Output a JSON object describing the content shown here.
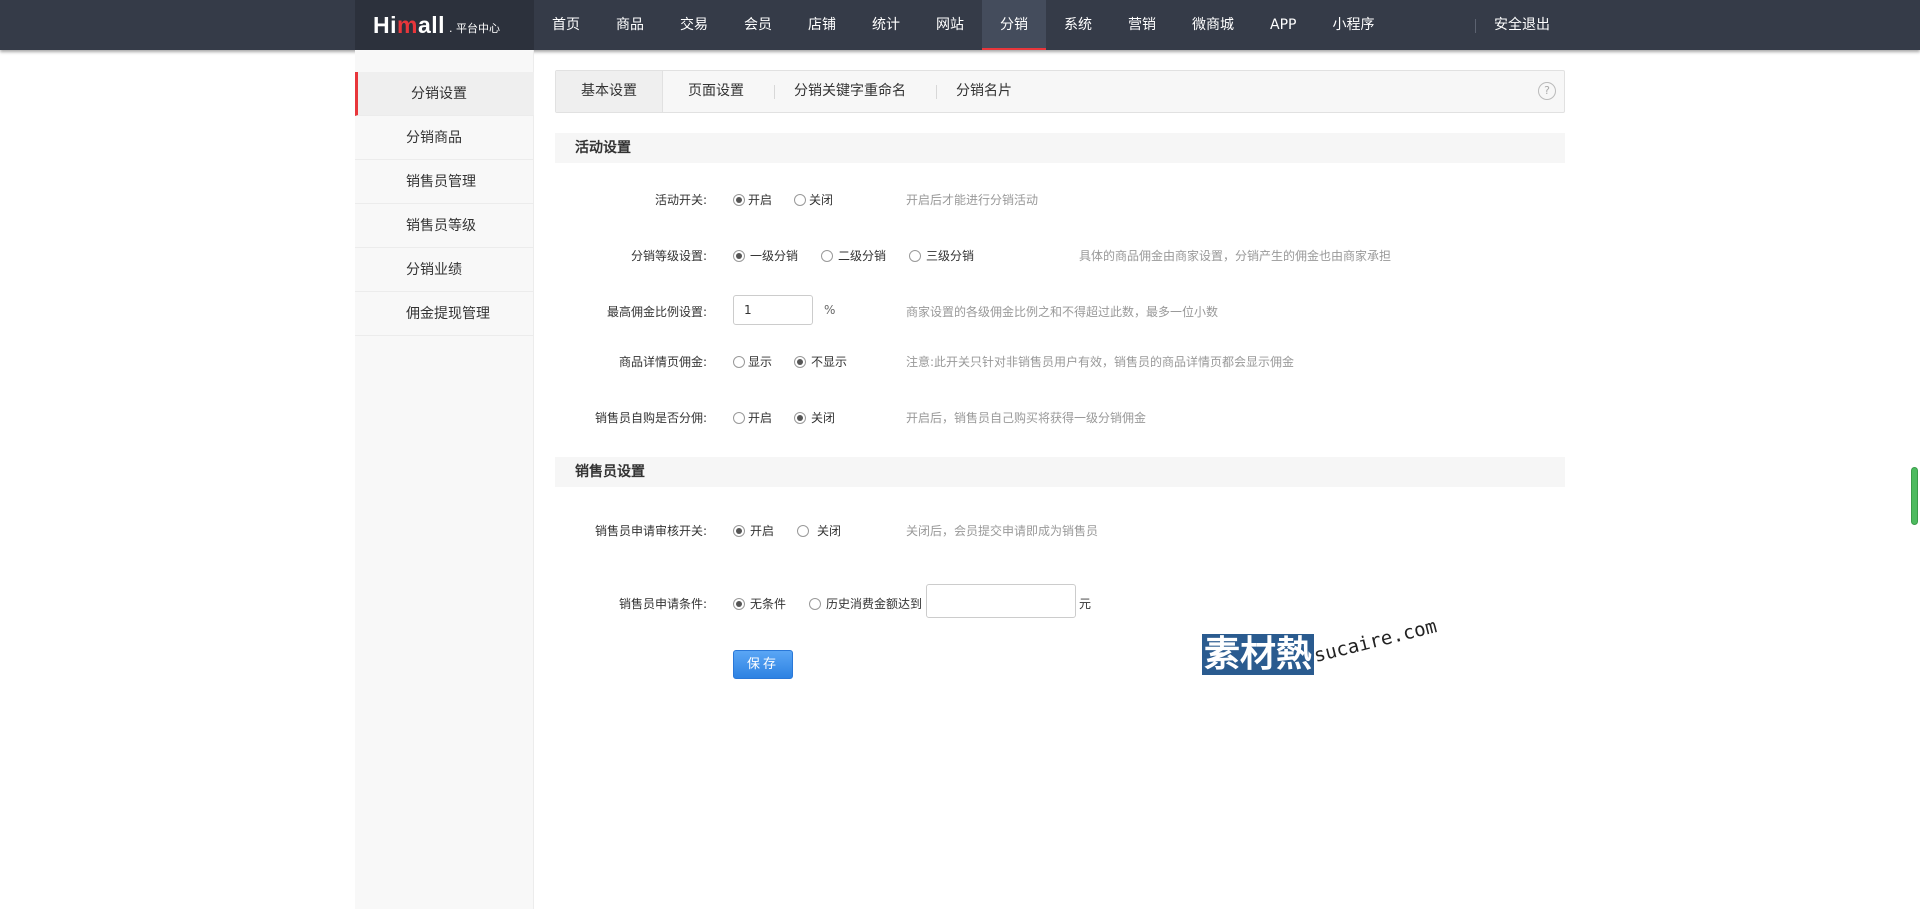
{
  "brand": {
    "logo_left": "Hi",
    "logo_m": "m",
    "logo_right": "all",
    "logo_sub": ". 平台中心"
  },
  "nav": {
    "items": [
      "首页",
      "商品",
      "交易",
      "会员",
      "店铺",
      "统计",
      "网站",
      "分销",
      "系统",
      "营销",
      "微商城",
      "APP",
      "小程序"
    ],
    "active": "分销",
    "logout": "安全退出"
  },
  "sidebar": {
    "items": [
      "分销设置",
      "分销商品",
      "销售员管理",
      "销售员等级",
      "分销业绩",
      "佣金提现管理"
    ],
    "active": "分销设置"
  },
  "tabs": {
    "items": [
      "基本设置",
      "页面设置",
      "分销关键字重命名",
      "分销名片"
    ],
    "help": "?"
  },
  "activity": {
    "title": "活动设置",
    "switch": {
      "label": "活动开关:",
      "on": "开启",
      "off": "关闭",
      "hint": "开启后才能进行分销活动"
    },
    "level": {
      "label": "分销等级设置:",
      "opt1": "一级分销",
      "opt2": "二级分销",
      "opt3": "三级分销",
      "hint": "具体的商品佣金由商家设置，分销产生的佣金也由商家承担"
    },
    "max_ratio": {
      "label": "最高佣金比例设置:",
      "value": "1",
      "unit": "%",
      "hint": "商家设置的各级佣金比例之和不得超过此数，最多一位小数"
    },
    "detail": {
      "label": "商品详情页佣金:",
      "show": "显示",
      "hide": "不显示",
      "hint": "注意:此开关只针对非销售员用户有效，销售员的商品详情页都会显示佣金"
    },
    "self_buy": {
      "label": "销售员自购是否分佣:",
      "on": "开启",
      "off": "关闭",
      "hint": "开启后，销售员自己购买将获得一级分销佣金"
    }
  },
  "seller": {
    "title": "销售员设置",
    "review": {
      "label": "销售员申请审核开关:",
      "on": "开启",
      "off": "关闭",
      "hint": "关闭后，会员提交申请即成为销售员"
    },
    "condition": {
      "label": "销售员申请条件:",
      "none": "无条件",
      "history": "历史消费金额达到",
      "value": "",
      "unit": "元"
    }
  },
  "actions": {
    "save": "保存"
  },
  "watermark": {
    "logo": "素材熱",
    "url": "sucaire.com"
  },
  "colors": {
    "topbar": "#353b48",
    "accent": "#e8363b",
    "primary": "#2d82e2"
  }
}
